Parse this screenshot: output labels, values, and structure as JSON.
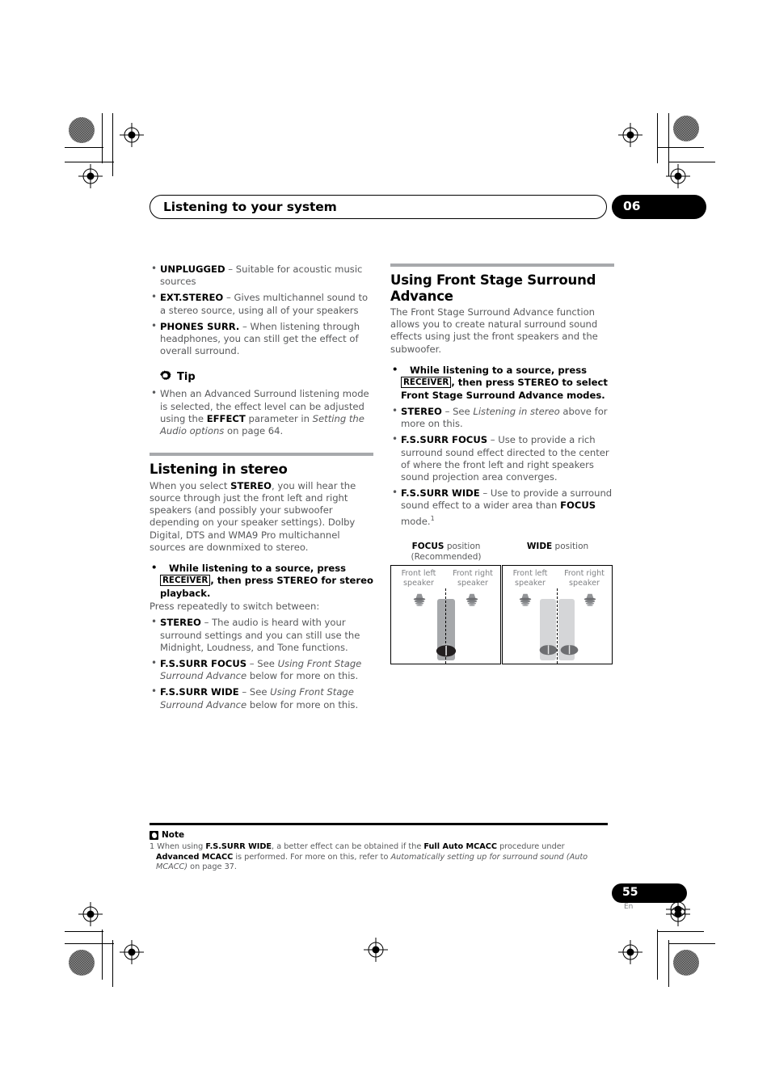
{
  "header": {
    "running_title": "Listening to your system",
    "chapter_number": "06"
  },
  "left_column": {
    "mode_list": [
      {
        "term": "UNPLUGGED",
        "dash": " – ",
        "desc": "Suitable for acoustic music sources"
      },
      {
        "term": "EXT.STEREO",
        "dash": " – ",
        "desc": "Gives multichannel sound to a stereo source, using all of your speakers"
      },
      {
        "term": "PHONES SURR.",
        "dash": " – ",
        "desc": "When listening through headphones, you can still get the effect of overall surround."
      }
    ],
    "tip": {
      "icon": "gear-icon",
      "label": "Tip",
      "text_1": "When an Advanced Surround listening mode is selected, the effect level can be adjusted using the ",
      "bold_1": "EFFECT",
      "text_2": " parameter in ",
      "italic_1": "Setting the Audio options",
      "text_3": " on page 64."
    },
    "section": {
      "heading": "Listening in stereo",
      "intro_1": "When you select ",
      "intro_bold": "STEREO",
      "intro_2": ", you will hear the source through just the front left and right speakers (and possibly your subwoofer depending on your speaker settings). Dolby Digital, DTS and WMA9 Pro multichannel sources are downmixed to stereo.",
      "instruction_1": "While listening to a source, press ",
      "instruction_key": "RECEIVER",
      "instruction_2": ", then press STEREO for stereo playback.",
      "sub_note": "Press repeatedly to switch between:",
      "items": [
        {
          "term": "STEREO",
          "dash": " – ",
          "desc": "The audio is heard with your surround settings and you can still use the Midnight, Loudness, and Tone functions."
        },
        {
          "term": "F.S.SURR FOCUS",
          "dash": " – ",
          "desc_pre": "See ",
          "desc_italic": "Using Front Stage Surround Advance",
          "desc_post": " below for more on this."
        },
        {
          "term": "F.S.SURR WIDE",
          "dash": " – ",
          "desc_pre": "See ",
          "desc_italic": "Using Front Stage Surround Advance",
          "desc_post": " below for more on this."
        }
      ]
    }
  },
  "right_column": {
    "heading": "Using Front Stage Surround Advance",
    "intro": "The Front Stage Surround Advance function allows you to create natural surround sound effects using just the front speakers and the subwoofer.",
    "instruction_1": "While listening to a source, press ",
    "instruction_key": "RECEIVER",
    "instruction_2": ", then press STEREO to select Front Stage Surround Advance modes.",
    "items": [
      {
        "term": "STEREO",
        "dash": " – ",
        "desc_pre": "See ",
        "desc_italic": "Listening in stereo",
        "desc_post": " above for more on this."
      },
      {
        "term": "F.S.SURR FOCUS",
        "dash": " – ",
        "desc_pre": "Use to provide a rich surround sound effect directed to the center of where the front left and right speakers sound projection area converges.",
        "desc_italic": "",
        "desc_post": ""
      },
      {
        "term": "F.S.SURR WIDE",
        "dash": " – ",
        "desc_pre": "Use to provide a surround sound effect to a wider area than ",
        "desc_bold": "FOCUS",
        "desc_post": " mode.",
        "footnote_marker": "1"
      }
    ]
  },
  "figure": {
    "panels": [
      {
        "title_bold": "FOCUS",
        "title_rest": " position",
        "subtitle": "(Recommended)",
        "speaker_left_line1": "Front left",
        "speaker_left_line2": "speaker",
        "speaker_right_line1": "Front right",
        "speaker_right_line2": "speaker",
        "beam_count": 1,
        "listener_count": 1,
        "beam_color": "#a6a8ab"
      },
      {
        "title_bold": "WIDE",
        "title_rest": " position",
        "subtitle": "",
        "speaker_left_line1": "Front left",
        "speaker_left_line2": "speaker",
        "speaker_right_line1": "Front right",
        "speaker_right_line2": "speaker",
        "beam_count": 2,
        "listener_count": 2,
        "beam_color": "#d5d6d8"
      }
    ]
  },
  "footnote": {
    "icon": "note-icon",
    "label": "Note",
    "number": "1",
    "t1": " When using ",
    "b1": "F.S.SURR WIDE",
    "t2": ", a better effect can be obtained if the ",
    "b2": "Full Auto MCACC",
    "t3": " procedure under ",
    "b3": "Advanced MCACC",
    "t4": " is performed. For more on this, refer to ",
    "i1": "Automatically setting up for surround sound (Auto MCACC)",
    "t5": " on page 37."
  },
  "footer": {
    "page_number": "55",
    "language": "En"
  }
}
